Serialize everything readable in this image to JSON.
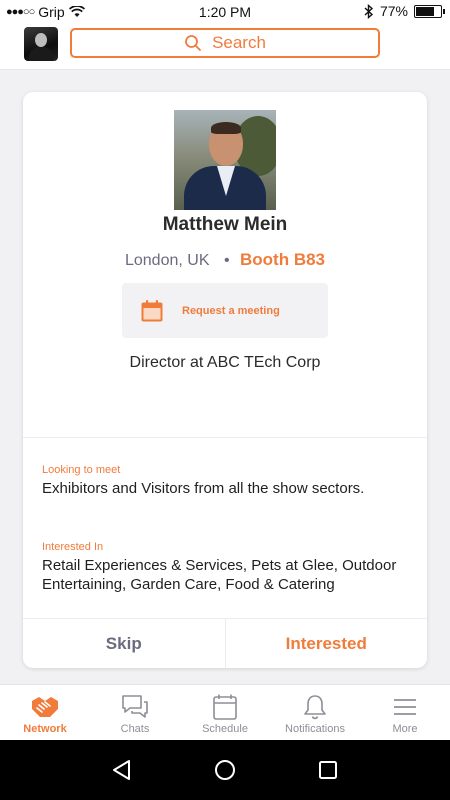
{
  "status_bar": {
    "signal_dots": "●●●○○",
    "carrier": "Grip",
    "time": "1:20 PM",
    "battery_percent": "77%",
    "battery_level": 0.77
  },
  "header": {
    "search_placeholder": "Search"
  },
  "profile": {
    "name": "Matthew Mein",
    "location": "London, UK",
    "separator": "•",
    "booth": "Booth B83",
    "request_meeting_label": "Request a meeting",
    "job_title": "Director at ABC TEch Corp",
    "looking_to_meet_label": "Looking to meet",
    "looking_to_meet_text": "Exhibitors and Visitors from all the show sectors.",
    "interested_in_label": "Interested In",
    "interested_in_text": "Retail Experiences & Services, Pets at Glee, Outdoor Entertaining, Garden Care, Food & Catering"
  },
  "actions": {
    "skip_label": "Skip",
    "interested_label": "Interested"
  },
  "tabs": [
    {
      "label": "Network",
      "icon": "handshake-icon",
      "active": true
    },
    {
      "label": "Chats",
      "icon": "chat-bubbles-icon",
      "active": false
    },
    {
      "label": "Schedule",
      "icon": "calendar-icon",
      "active": false
    },
    {
      "label": "Notifications",
      "icon": "bell-icon",
      "active": false
    },
    {
      "label": "More",
      "icon": "menu-icon",
      "active": false
    }
  ],
  "colors": {
    "accent": "#f07c3c",
    "muted_text": "#6b6b80",
    "inactive_tab": "#8e8e98"
  }
}
